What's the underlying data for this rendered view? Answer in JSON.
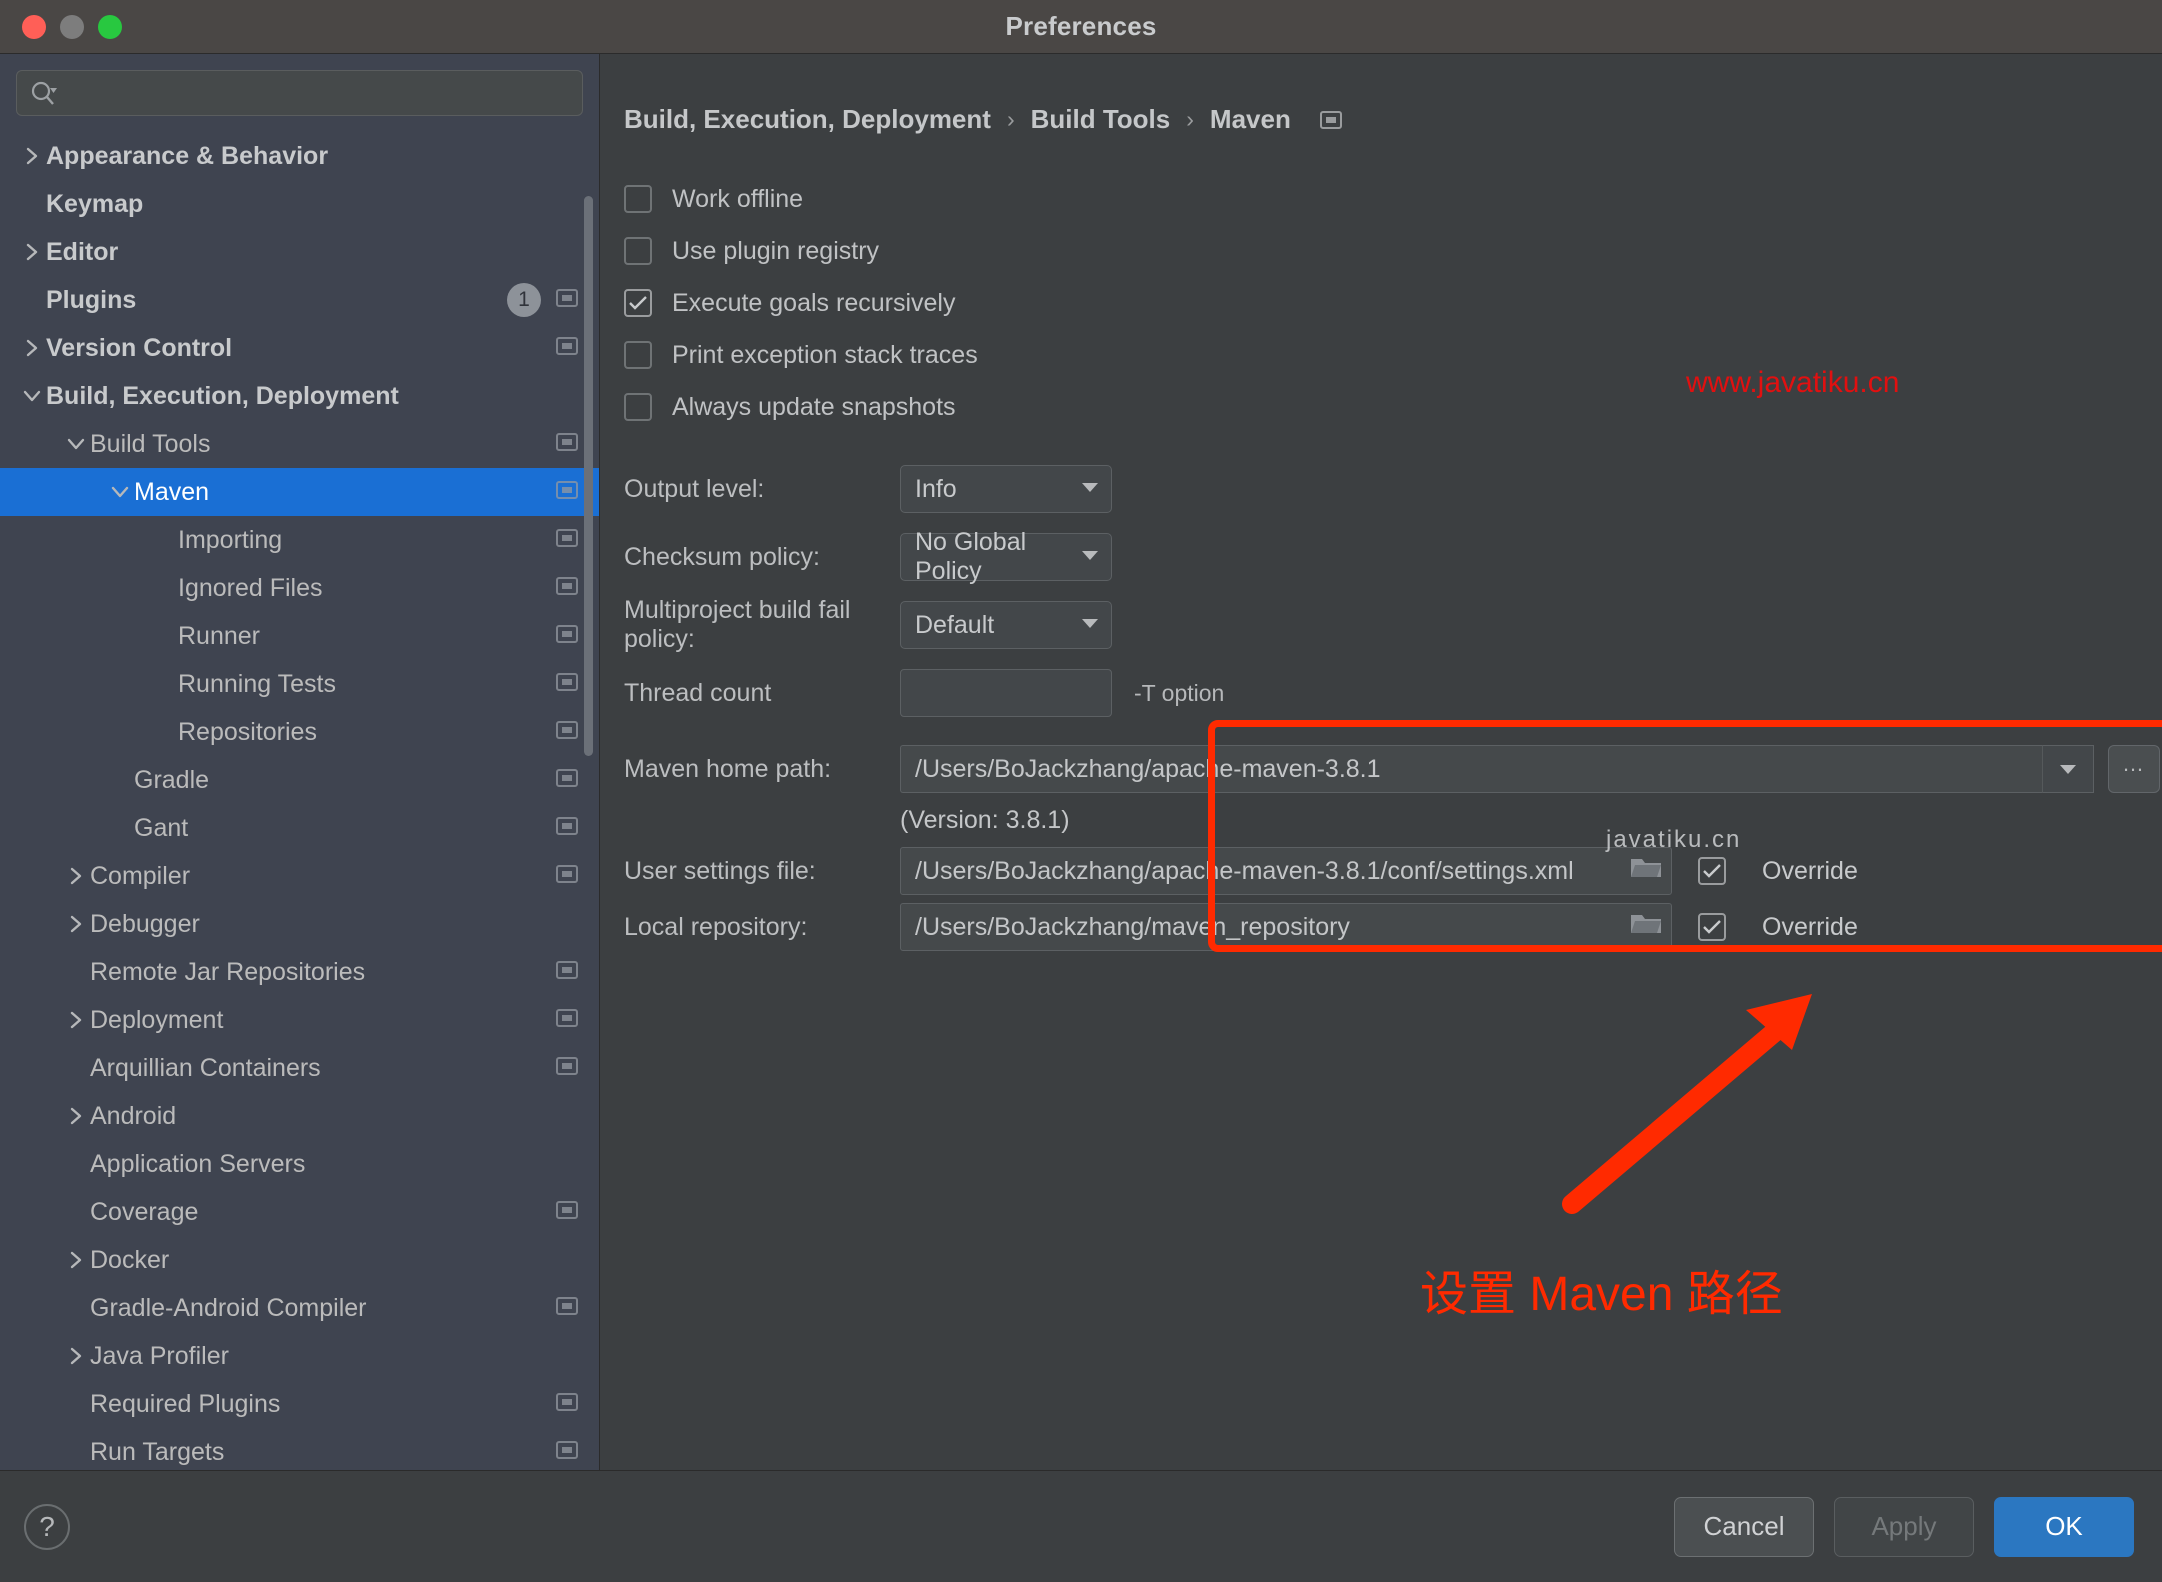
{
  "window": {
    "title": "Preferences",
    "traffic_lights": [
      "close-red",
      "minimize-yellow",
      "zoom-green"
    ]
  },
  "sidebar": {
    "search": {
      "placeholder": "",
      "value": "",
      "icon": "search-icon"
    },
    "items": [
      {
        "label": "Appearance & Behavior",
        "indent": 0,
        "twisty": "collapsed",
        "bold": true,
        "badge": null,
        "cfg": false,
        "selected": false
      },
      {
        "label": "Keymap",
        "indent": 0,
        "twisty": "none",
        "bold": true,
        "badge": null,
        "cfg": false,
        "selected": false
      },
      {
        "label": "Editor",
        "indent": 0,
        "twisty": "collapsed",
        "bold": true,
        "badge": null,
        "cfg": false,
        "selected": false
      },
      {
        "label": "Plugins",
        "indent": 0,
        "twisty": "none",
        "bold": true,
        "badge": "1",
        "cfg": true,
        "selected": false
      },
      {
        "label": "Version Control",
        "indent": 0,
        "twisty": "collapsed",
        "bold": true,
        "badge": null,
        "cfg": true,
        "selected": false
      },
      {
        "label": "Build, Execution, Deployment",
        "indent": 0,
        "twisty": "expanded",
        "bold": true,
        "badge": null,
        "cfg": false,
        "selected": false
      },
      {
        "label": "Build Tools",
        "indent": 1,
        "twisty": "expanded",
        "bold": false,
        "badge": null,
        "cfg": true,
        "selected": false
      },
      {
        "label": "Maven",
        "indent": 2,
        "twisty": "expanded",
        "bold": false,
        "badge": null,
        "cfg": true,
        "selected": true
      },
      {
        "label": "Importing",
        "indent": 3,
        "twisty": "none",
        "bold": false,
        "badge": null,
        "cfg": true,
        "selected": false
      },
      {
        "label": "Ignored Files",
        "indent": 3,
        "twisty": "none",
        "bold": false,
        "badge": null,
        "cfg": true,
        "selected": false
      },
      {
        "label": "Runner",
        "indent": 3,
        "twisty": "none",
        "bold": false,
        "badge": null,
        "cfg": true,
        "selected": false
      },
      {
        "label": "Running Tests",
        "indent": 3,
        "twisty": "none",
        "bold": false,
        "badge": null,
        "cfg": true,
        "selected": false
      },
      {
        "label": "Repositories",
        "indent": 3,
        "twisty": "none",
        "bold": false,
        "badge": null,
        "cfg": true,
        "selected": false
      },
      {
        "label": "Gradle",
        "indent": 2,
        "twisty": "none",
        "bold": false,
        "badge": null,
        "cfg": true,
        "selected": false
      },
      {
        "label": "Gant",
        "indent": 2,
        "twisty": "none",
        "bold": false,
        "badge": null,
        "cfg": true,
        "selected": false
      },
      {
        "label": "Compiler",
        "indent": 1,
        "twisty": "collapsed",
        "bold": false,
        "badge": null,
        "cfg": true,
        "selected": false
      },
      {
        "label": "Debugger",
        "indent": 1,
        "twisty": "collapsed",
        "bold": false,
        "badge": null,
        "cfg": false,
        "selected": false
      },
      {
        "label": "Remote Jar Repositories",
        "indent": 1,
        "twisty": "none",
        "bold": false,
        "badge": null,
        "cfg": true,
        "selected": false
      },
      {
        "label": "Deployment",
        "indent": 1,
        "twisty": "collapsed",
        "bold": false,
        "badge": null,
        "cfg": true,
        "selected": false
      },
      {
        "label": "Arquillian Containers",
        "indent": 1,
        "twisty": "none",
        "bold": false,
        "badge": null,
        "cfg": true,
        "selected": false
      },
      {
        "label": "Android",
        "indent": 1,
        "twisty": "collapsed",
        "bold": false,
        "badge": null,
        "cfg": false,
        "selected": false
      },
      {
        "label": "Application Servers",
        "indent": 1,
        "twisty": "none",
        "bold": false,
        "badge": null,
        "cfg": false,
        "selected": false
      },
      {
        "label": "Coverage",
        "indent": 1,
        "twisty": "none",
        "bold": false,
        "badge": null,
        "cfg": true,
        "selected": false
      },
      {
        "label": "Docker",
        "indent": 1,
        "twisty": "collapsed",
        "bold": false,
        "badge": null,
        "cfg": false,
        "selected": false
      },
      {
        "label": "Gradle-Android Compiler",
        "indent": 1,
        "twisty": "none",
        "bold": false,
        "badge": null,
        "cfg": true,
        "selected": false
      },
      {
        "label": "Java Profiler",
        "indent": 1,
        "twisty": "collapsed",
        "bold": false,
        "badge": null,
        "cfg": false,
        "selected": false
      },
      {
        "label": "Required Plugins",
        "indent": 1,
        "twisty": "none",
        "bold": false,
        "badge": null,
        "cfg": true,
        "selected": false
      },
      {
        "label": "Run Targets",
        "indent": 1,
        "twisty": "none",
        "bold": false,
        "badge": null,
        "cfg": true,
        "selected": false
      }
    ]
  },
  "main": {
    "breadcrumb": [
      "Build, Execution, Deployment",
      "Build Tools",
      "Maven"
    ],
    "breadcrumb_separator": "›",
    "breadcrumb_icon": "settings-reset-icon",
    "checkboxes": [
      {
        "label": "Work offline",
        "checked": false
      },
      {
        "label": "Use plugin registry",
        "checked": false
      },
      {
        "label": "Execute goals recursively",
        "checked": true
      },
      {
        "label": "Print exception stack traces",
        "checked": false
      },
      {
        "label": "Always update snapshots",
        "checked": false
      }
    ],
    "fields": {
      "output_level": {
        "label": "Output level:",
        "value": "Info",
        "type": "select"
      },
      "checksum_policy": {
        "label": "Checksum policy:",
        "value": "No Global Policy",
        "type": "select"
      },
      "multiproject_policy": {
        "label": "Multiproject build fail policy:",
        "value": "Default",
        "type": "select"
      },
      "thread_count": {
        "label": "Thread count",
        "value": "",
        "hint": "-T option",
        "type": "text"
      }
    },
    "paths": {
      "maven_home": {
        "label": "Maven home path:",
        "value": "/Users/BoJackzhang/apache-maven-3.8.1",
        "browse_label": "…"
      },
      "version_note": "(Version: 3.8.1)",
      "user_settings": {
        "label": "User settings file:",
        "value": "/Users/BoJackzhang/apache-maven-3.8.1/conf/settings.xml",
        "override_label": "Override",
        "override_checked": true
      },
      "local_repo": {
        "label": "Local repository:",
        "value": "/Users/BoJackzhang/maven_repository",
        "override_label": "Override",
        "override_checked": true
      }
    },
    "highlight_color": "#ff2a00",
    "annotation": {
      "text": "设置 Maven 路径",
      "color": "#ff2a00",
      "arrow": "up-right-arrow"
    },
    "watermarks": [
      {
        "text": "www.javatiku.cn",
        "color": "#e11010"
      },
      {
        "text": "javatiku.cn",
        "color": "#cfd1d3"
      }
    ]
  },
  "footer": {
    "help_label": "?",
    "cancel_label": "Cancel",
    "apply_label": "Apply",
    "ok_label": "OK",
    "accent_color": "#2b77c1"
  }
}
